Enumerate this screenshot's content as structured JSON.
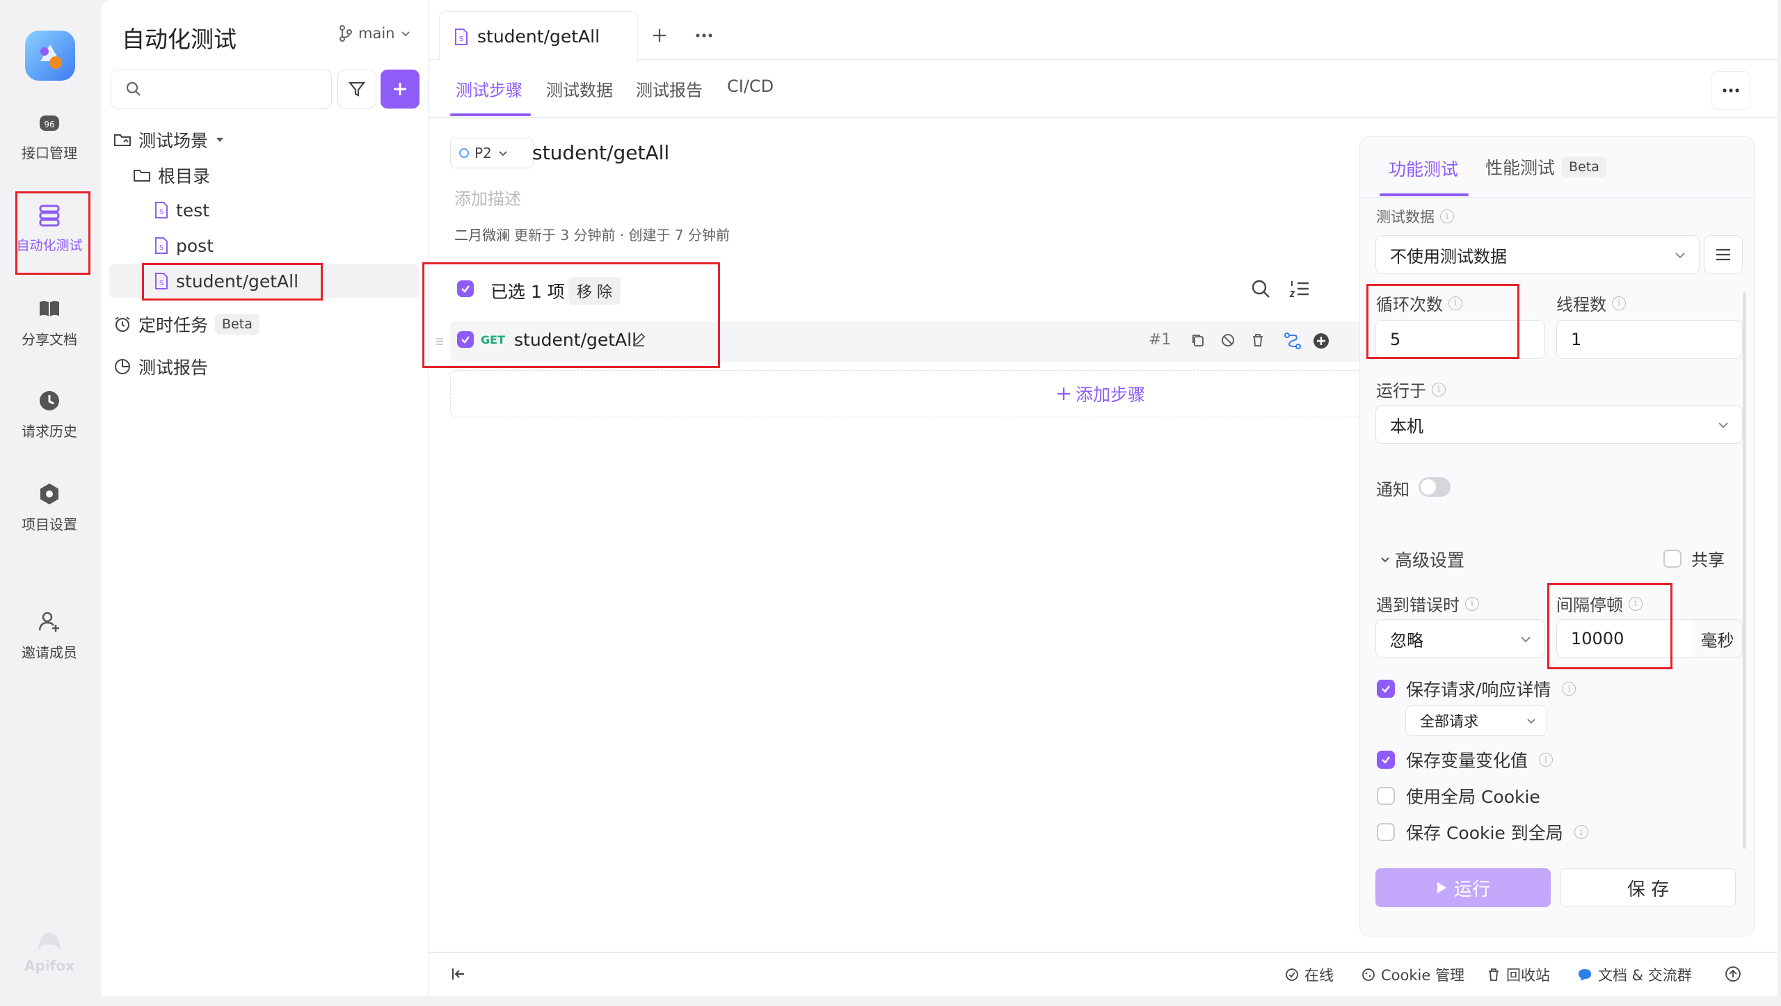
{
  "rail": {
    "items": [
      {
        "label": "接口管理",
        "icon": "api-icon"
      },
      {
        "label": "自动化测试",
        "icon": "automation-icon"
      },
      {
        "label": "分享文档",
        "icon": "book-icon"
      },
      {
        "label": "请求历史",
        "icon": "clock-icon"
      },
      {
        "label": "项目设置",
        "icon": "settings-icon"
      },
      {
        "label": "邀请成员",
        "icon": "add-user-icon"
      }
    ],
    "brand": "Apifox"
  },
  "sidebar": {
    "title": "自动化测试",
    "branch": "main",
    "search_placeholder": "",
    "tree": {
      "scenes": "测试场景",
      "root": "根目录",
      "items": [
        "test",
        "post",
        "student/getAll"
      ],
      "scheduled": "定时任务",
      "scheduled_badge": "Beta",
      "reports": "测试报告"
    }
  },
  "tabs": {
    "open_tab": "student/getAll",
    "add": "+",
    "more": "···",
    "sub": [
      "测试步骤",
      "测试数据",
      "测试报告",
      "CI/CD"
    ]
  },
  "scenario": {
    "priority": "P2",
    "name": "student/getAll",
    "desc_placeholder": "添加描述",
    "author": "二月微澜",
    "meta": "更新于 3 分钟前 · 创建于 7 分钟前",
    "selected": "已选 1 项",
    "remove": "移 除",
    "step": {
      "method": "GET",
      "name": "student/getAll",
      "index": "#1"
    },
    "add_step": "添加步骤"
  },
  "settings": {
    "tabs": [
      "功能测试",
      "性能测试"
    ],
    "perf_badge": "Beta",
    "test_data_label": "测试数据",
    "test_data_value": "不使用测试数据",
    "loop_label": "循环次数",
    "loop_value": "5",
    "threads_label": "线程数",
    "threads_value": "1",
    "run_on_label": "运行于",
    "run_on_value": "本机",
    "notify_label": "通知",
    "notify_on": false,
    "advanced": "高级设置",
    "share": "共享",
    "on_error_label": "遇到错误时",
    "on_error_value": "忽略",
    "interval_label": "间隔停顿",
    "interval_value": "10000",
    "interval_unit": "毫秒",
    "save_details": "保存请求/响应详情",
    "save_details_scope": "全部请求",
    "save_vars": "保存变量变化值",
    "global_cookie": "使用全局 Cookie",
    "save_cookie": "保存 Cookie 到全局",
    "run": "运行",
    "save": "保 存"
  },
  "footer": {
    "online": "在线",
    "cookie": "Cookie 管理",
    "trash": "回收站",
    "docs": "文档 & 交流群"
  },
  "colors": {
    "accent": "#8e5cf7",
    "highlight": "#e2242a",
    "get": "#1aa87a"
  }
}
